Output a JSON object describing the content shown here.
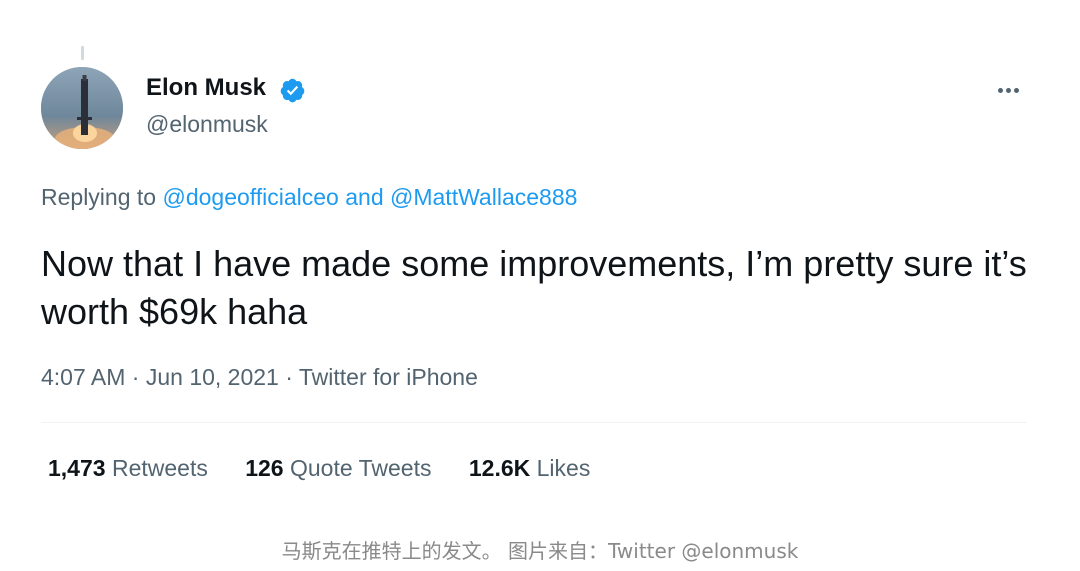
{
  "tweet": {
    "author": {
      "display_name": "Elon Musk",
      "handle": "@elonmusk",
      "verified": true
    },
    "reply_context": {
      "prefix": "Replying to",
      "mention_1": "@dogeofficialceo",
      "conjunction": "and",
      "mention_2": "@MattWallace888"
    },
    "text": "Now that I have made some improvements, I’m pretty sure it’s worth $69k haha",
    "meta": {
      "time": "4:07 AM",
      "separator": "·",
      "date": "Jun 10, 2021",
      "source": "Twitter for iPhone"
    },
    "stats": {
      "retweets_count": "1,473",
      "retweets_label": "Retweets",
      "quote_tweets_count": "126",
      "quote_tweets_label": "Quote Tweets",
      "likes_count": "12.6K",
      "likes_label": "Likes"
    }
  },
  "caption": "马斯克在推特上的发文。 图片来自：Twitter @elonmusk",
  "icons": {
    "verified": "verified-badge-icon",
    "more": "more-options-icon"
  },
  "colors": {
    "accent": "#1d9bf0",
    "text_primary": "#0f1419",
    "text_secondary": "#536471",
    "caption": "#8a8a8a"
  }
}
